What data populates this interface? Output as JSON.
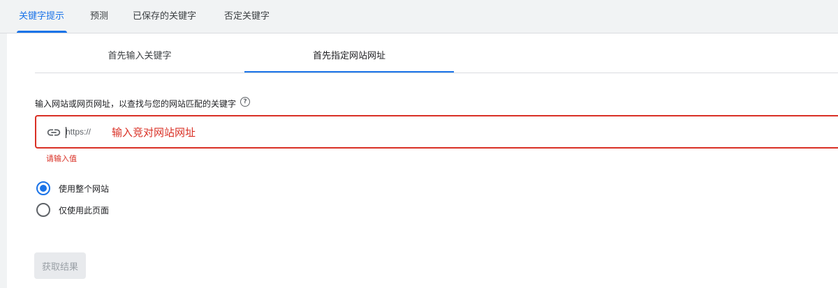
{
  "top_tabs": [
    {
      "label": "关键字提示",
      "active": true
    },
    {
      "label": "预测",
      "active": false
    },
    {
      "label": "已保存的关键字",
      "active": false
    },
    {
      "label": "否定关键字",
      "active": false
    }
  ],
  "sub_tabs": [
    {
      "label": "首先输入关键字",
      "active": false
    },
    {
      "label": "首先指定网站网址",
      "active": true
    }
  ],
  "prompt": "输入网站或网页网址，以查找与您的网站匹配的关键字",
  "help_icon": "question-circle",
  "url_field": {
    "icon": "link",
    "prefix": "https://",
    "placeholder": "输入竞对网站网址",
    "value": ""
  },
  "error": "请输入值",
  "scope_options": [
    {
      "label": "使用整个网站",
      "checked": true
    },
    {
      "label": "仅使用此页面",
      "checked": false
    }
  ],
  "submit_label": "获取结果",
  "colors": {
    "accent": "#1a73e8",
    "error": "#d93025",
    "background": "#f1f3f4"
  }
}
